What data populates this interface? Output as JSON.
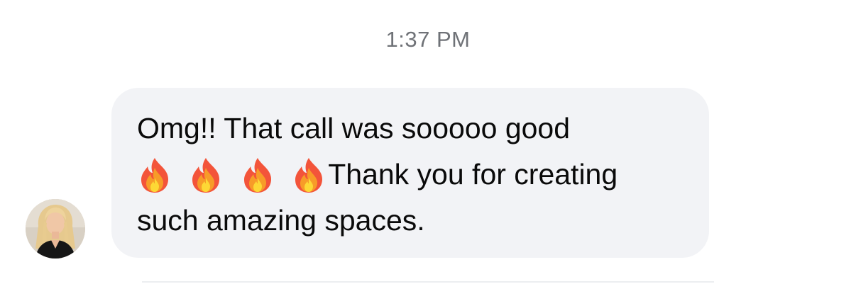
{
  "timestamp": "1:37 PM",
  "message": {
    "line1": "Omg!! That call was sooooo good",
    "emoji_count": 4,
    "emoji": "fire-emoji",
    "line2": "Thank you for creating",
    "line3": "such amazing spaces."
  },
  "colors": {
    "bubble": "#f2f3f6",
    "timestamp": "#6f7277",
    "text": "#0a0a0a"
  }
}
